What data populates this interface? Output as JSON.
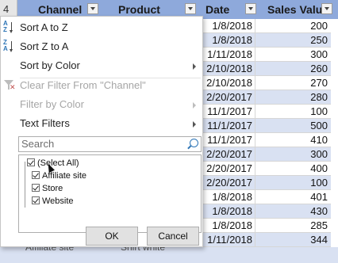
{
  "sheet": {
    "row_header": "4",
    "columns": [
      "Channel",
      "Product",
      "Date",
      "Sales Value"
    ],
    "dates": [
      "1/8/2018",
      "1/8/2018",
      "1/11/2018",
      "2/10/2018",
      "2/10/2018",
      "2/20/2017",
      "11/1/2017",
      "11/1/2017",
      "11/1/2017",
      "2/20/2017",
      "2/20/2017",
      "2/20/2017",
      "1/8/2018",
      "1/8/2018",
      "1/8/2018",
      "1/11/2018"
    ],
    "values": [
      "200",
      "250",
      "300",
      "260",
      "270",
      "280",
      "100",
      "500",
      "410",
      "300",
      "400",
      "100",
      "401",
      "430",
      "285",
      "344"
    ],
    "bottom_partial": [
      "Affiliate site",
      "Shirt white",
      "344"
    ]
  },
  "menu": {
    "sort_az": "Sort A to Z",
    "sort_za": "Sort Z to A",
    "sort_color": "Sort by Color",
    "clear_filter": "Clear Filter From \"Channel\"",
    "filter_color": "Filter by Color",
    "text_filters": "Text Filters",
    "search_placeholder": "Search",
    "items": [
      "(Select All)",
      "Affiliate site",
      "Store",
      "Website"
    ],
    "ok": "OK",
    "cancel": "Cancel"
  },
  "colors": {
    "header_bg": "#8ea9db",
    "band": "#d9e1f2",
    "accent": "#2e75b6"
  }
}
